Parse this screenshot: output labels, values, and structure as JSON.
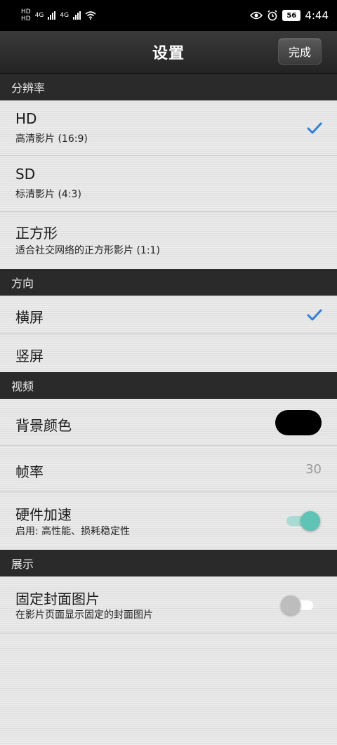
{
  "status_bar": {
    "network_labels": [
      "HD",
      "HD"
    ],
    "signal_label_1": "4G",
    "signal_label_2": "4G",
    "battery": "56",
    "time": "4:44",
    "icons": [
      "eye-icon",
      "alarm-icon",
      "wifi-icon"
    ]
  },
  "header": {
    "title": "设置",
    "done_label": "完成"
  },
  "sections": {
    "resolution": {
      "header": "分辨率",
      "items": [
        {
          "title": "HD",
          "subtitle": "高清影片 (16:9)",
          "selected": true
        },
        {
          "title": "SD",
          "subtitle": "标清影片 (4:3)",
          "selected": false
        },
        {
          "title": "正方形",
          "subtitle": "适合社交网络的正方形影片 (1:1)",
          "selected": false
        }
      ]
    },
    "orientation": {
      "header": "方向",
      "items": [
        {
          "title": "横屏",
          "selected": true
        },
        {
          "title": "竖屏",
          "selected": false
        }
      ]
    },
    "video": {
      "header": "视频",
      "background_color": {
        "title": "背景颜色",
        "color": "#000000"
      },
      "frame_rate": {
        "title": "帧率",
        "value": "30"
      },
      "hw_accel": {
        "title": "硬件加速",
        "subtitle": "启用: 高性能、损耗稳定性",
        "enabled": true
      }
    },
    "display": {
      "header": "展示",
      "fixed_cover": {
        "title": "固定封面图片",
        "subtitle": "在影片页面显示固定的封面图片",
        "enabled": false
      }
    }
  },
  "colors": {
    "accent": "#2f7fe0",
    "toggle_on_track": "#a8dbd3",
    "toggle_on_thumb": "#5fc3b5",
    "toggle_off_track": "#ffffff",
    "toggle_off_thumb": "#bdbdbd"
  }
}
